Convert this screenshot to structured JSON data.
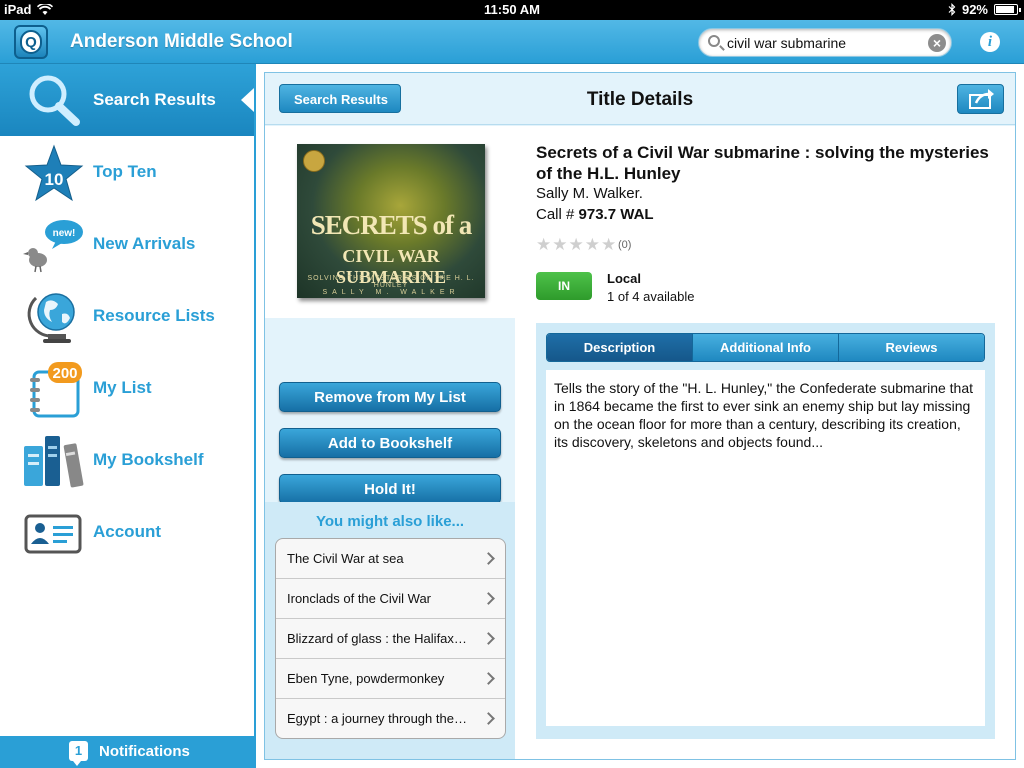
{
  "status_bar": {
    "device": "iPad",
    "time": "11:50 AM",
    "battery": "92%",
    "battery_level": 0.92
  },
  "header": {
    "school_name": "Anderson Middle School",
    "search_value": "civil war submarine"
  },
  "sidebar": {
    "items": [
      {
        "label": "Search Results",
        "icon": "magnifier-icon"
      },
      {
        "label": "Top Ten",
        "icon": "star-10-icon",
        "badge": "10"
      },
      {
        "label": "New Arrivals",
        "icon": "new-bird-icon",
        "badge": "new!"
      },
      {
        "label": "Resource Lists",
        "icon": "globe-icon"
      },
      {
        "label": "My List",
        "icon": "notebook-icon",
        "badge": "200"
      },
      {
        "label": "My Bookshelf",
        "icon": "books-icon"
      },
      {
        "label": "Account",
        "icon": "id-card-icon"
      }
    ],
    "notifications": {
      "count": "1",
      "label": "Notifications"
    }
  },
  "detail": {
    "back_label": "Search Results",
    "title": "Title Details",
    "cover": {
      "title_line1": "SECRETS of a",
      "title_line2": "CIVIL WAR SUBMARINE",
      "subtitle": "SOLVING THE MYSTERIES OF THE H. L. HUNLEY",
      "author": "SALLY M. WALKER"
    },
    "actions": [
      "Remove from My List",
      "Add to Bookshelf",
      "Hold It!"
    ],
    "also_like": {
      "heading": "You might also like...",
      "items": [
        "The Civil War at sea",
        "Ironclads of the Civil War",
        "Blizzard of glass : the Halifax…",
        "Eben Tyne, powdermonkey",
        "Egypt : a journey through the…"
      ]
    },
    "book": {
      "title": "Secrets of a Civil War submarine : solving the mysteries of the H.L. Hunley",
      "author": "Sally M. Walker.",
      "call_prefix": "Call # ",
      "call_number": "973.7 WAL",
      "rating_count": "(0)",
      "status": "IN",
      "location": "Local",
      "availability": "1 of 4 available"
    },
    "tabs": [
      "Description",
      "Additional Info",
      "Reviews"
    ],
    "active_tab": "Description",
    "description": "Tells the story of the \"H. L. Hunley,\" the Confederate submarine that in 1864 became the first to ever sink an enemy ship but lay missing on the ocean floor for more than a century, describing its creation, its discovery, skeletons and objects found..."
  },
  "colors": {
    "accent": "#2a9fd6",
    "in_badge": "#3aae36",
    "panel_bg": "#e3f3fb"
  }
}
